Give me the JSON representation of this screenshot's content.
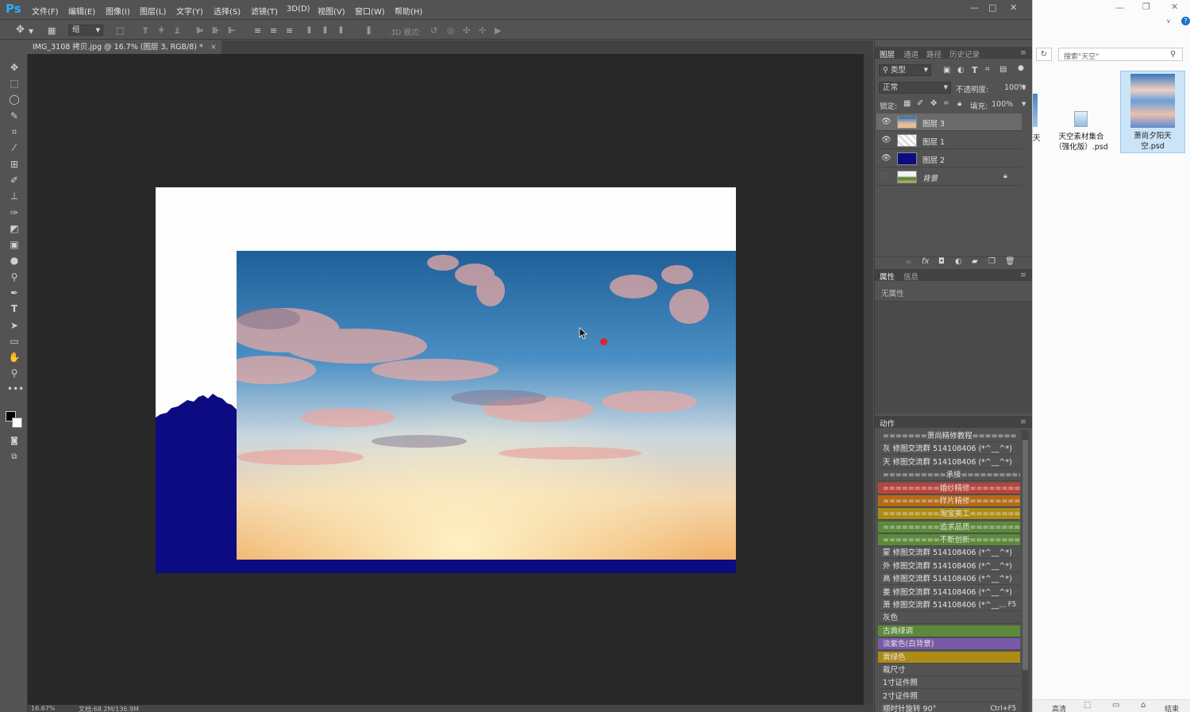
{
  "app": {
    "logo": "Ps"
  },
  "menu": [
    "文件(F)",
    "编辑(E)",
    "图像(I)",
    "图层(L)",
    "文字(Y)",
    "选择(S)",
    "滤镜(T)",
    "3D(D)",
    "视图(V)",
    "窗口(W)",
    "帮助(H)"
  ],
  "options": {
    "auto_select_value": "组",
    "mode_3d": "3D 模式:"
  },
  "document": {
    "tab_title": "IMG_3108 拷贝.jpg @ 16.7% (图层 3, RGB/8) *"
  },
  "status": {
    "zoom": "16.67%",
    "doc_size": "文档:68.2M/136.9M"
  },
  "layers_panel": {
    "tabs": [
      "图层",
      "通道",
      "路径",
      "历史记录"
    ],
    "filter_label": "类型",
    "blend_mode": "正常",
    "opacity_label": "不透明度:",
    "opacity_value": "100%",
    "lock_label": "锁定:",
    "fill_label": "填充:",
    "fill_value": "100%",
    "layers": [
      {
        "name": "图层 3",
        "visible": true
      },
      {
        "name": "图层 1",
        "visible": true
      },
      {
        "name": "图层 2",
        "visible": true
      },
      {
        "name": "背景",
        "visible": false
      }
    ]
  },
  "properties_panel": {
    "tabs": [
      "属性",
      "信息"
    ],
    "empty_text": "无属性"
  },
  "actions_panel": {
    "title": "动作",
    "items": [
      {
        "label": "=======萧尚精修教程=======",
        "color": "#535353"
      },
      {
        "label": "灰 修图交流群 514108406 (*^__^*)",
        "color": "#535353"
      },
      {
        "label": "天 修图交流群 514108406 (*^__^*)",
        "color": "#535353"
      },
      {
        "label": "==========承接==========",
        "color": "#535353"
      },
      {
        "label": "=========婚纱精修========",
        "color": "#b8453c"
      },
      {
        "label": "=========样片精修========",
        "color": "#b56a16"
      },
      {
        "label": "=========淘宝美工========",
        "color": "#ad8c15"
      },
      {
        "label": "=========追求品质========",
        "color": "#5c8a3a"
      },
      {
        "label": "=========不断创新========",
        "color": "#5c8a3a"
      },
      {
        "label": "蒙 修图交流群 514108406 (*^__^*)",
        "color": "#535353"
      },
      {
        "label": "外 修图交流群 514108406 (*^__^*)",
        "color": "#535353"
      },
      {
        "label": "高 修图交流群 514108406 (*^__^*)",
        "color": "#535353"
      },
      {
        "label": "姜 修图交流群 514108406 (*^__^*)",
        "color": "#535353"
      },
      {
        "label": "萧 修图交流群 514108406 (*^__...",
        "color": "#535353",
        "shortcut": "F5"
      },
      {
        "label": "灰色",
        "color": "#535353"
      },
      {
        "label": "古典绿调",
        "color": "#5c8a3a"
      },
      {
        "label": "淡紫色(白背景)",
        "color": "#7a5aa6"
      },
      {
        "label": "黄绿色",
        "color": "#ad8c15"
      },
      {
        "label": "裁尺寸",
        "color": "#535353"
      },
      {
        "label": "1寸证件照",
        "color": "#535353"
      },
      {
        "label": "2寸证件照",
        "color": "#535353"
      },
      {
        "label": "顺时针旋转 90°",
        "color": "#535353",
        "shortcut": "Ctrl+F5"
      }
    ]
  },
  "explorer": {
    "search_placeholder": "搜索\"天空\"",
    "partial_file_label": "天",
    "files": [
      {
        "name": "天空素材集合（强化版）.psd"
      },
      {
        "name": "萧尚夕阳天空.psd",
        "selected": true
      }
    ],
    "status_items": [
      "高清",
      "结束"
    ]
  },
  "colors": {
    "accent": "#31a8ff",
    "canvas_blue": "#0d0b82",
    "cursor_red": "#d9262b"
  }
}
